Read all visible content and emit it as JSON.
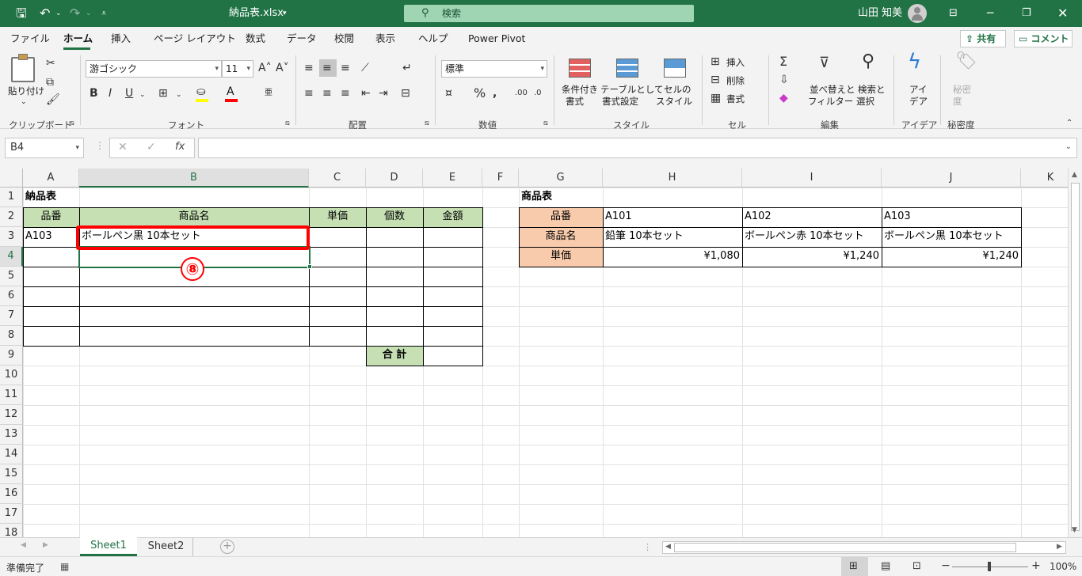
{
  "titlebar": {
    "filename": "納品表.xlsx",
    "search": "検索",
    "user": "山田 知美"
  },
  "tabs": [
    "ファイル",
    "ホーム",
    "挿入",
    "ページ レイアウト",
    "数式",
    "データ",
    "校閲",
    "表示",
    "ヘルプ",
    "Power Pivot"
  ],
  "share": "共有",
  "comment": "コメント",
  "ribbon": {
    "clipboard": {
      "paste": "貼り付け",
      "label": "クリップボード"
    },
    "font": {
      "name": "游ゴシック",
      "size": "11",
      "label": "フォント",
      "bold": "B",
      "italic": "I",
      "underline": "U"
    },
    "alignment": {
      "label": "配置"
    },
    "number": {
      "format": "標準",
      "label": "数値"
    },
    "styles": {
      "cond1": "条件付き",
      "cond2": "書式",
      "table1": "テーブルとして",
      "table2": "書式設定",
      "cell1": "セルの",
      "cell2": "スタイル",
      "label": "スタイル"
    },
    "cells": {
      "insert": "挿入",
      "delete": "削除",
      "format": "書式",
      "label": "セル"
    },
    "editing": {
      "sort1": "並べ替えと",
      "sort2": "フィルター",
      "find1": "検索と",
      "find2": "選択",
      "label": "編集"
    },
    "ideas": {
      "l1": "アイ",
      "l2": "デア",
      "label": "アイデア"
    },
    "sensitivity": {
      "l1": "秘密",
      "l2": "度",
      "label": "秘密度"
    }
  },
  "namebox": "B4",
  "columns": [
    "A",
    "B",
    "C",
    "D",
    "E",
    "F",
    "G",
    "H",
    "I",
    "J",
    "K"
  ],
  "rows": [
    "1",
    "2",
    "3",
    "4",
    "5",
    "6",
    "7",
    "8",
    "9",
    "10",
    "11",
    "12",
    "13",
    "14",
    "15",
    "16",
    "17",
    "18"
  ],
  "sheet": {
    "a1": "納品表",
    "hdr": {
      "code": "品番",
      "name": "商品名",
      "price": "単価",
      "qty": "個数",
      "amount": "金額"
    },
    "a3": "A103",
    "b3": "ボールペン黒 10本セット",
    "total": "合 計",
    "annotation": "⑧"
  },
  "product": {
    "title": "商品表",
    "labels": [
      "品番",
      "商品名",
      "単価"
    ],
    "codes": [
      "A101",
      "A102",
      "A103"
    ],
    "names": [
      "鉛筆 10本セット",
      "ボールペン赤 10本セット",
      "ボールペン黒 10本セット"
    ],
    "prices": [
      "¥1,080",
      "¥1,240",
      "¥1,240"
    ]
  },
  "sheets": [
    "Sheet1",
    "Sheet2"
  ],
  "status": {
    "ready": "準備完了",
    "zoom": "100%"
  }
}
